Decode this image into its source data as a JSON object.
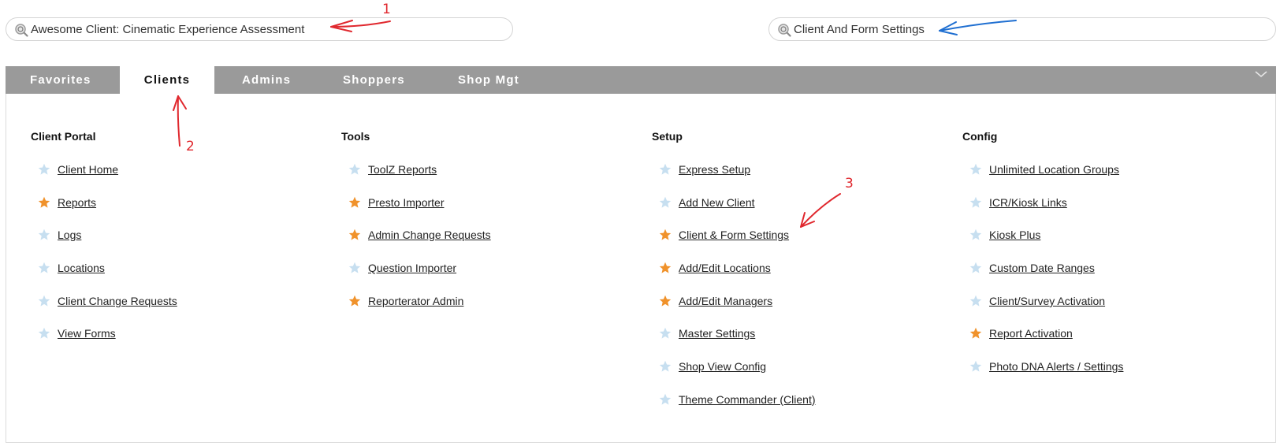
{
  "search_left": {
    "value": "Awesome Client: Cinematic Experience Assessment",
    "icon": "search-icon"
  },
  "search_right": {
    "value": "Client And Form Settings",
    "icon": "search-icon"
  },
  "tabs": [
    {
      "label": "Favorites",
      "active": false
    },
    {
      "label": "Clients",
      "active": true
    },
    {
      "label": "Admins",
      "active": false
    },
    {
      "label": "Shoppers",
      "active": false
    },
    {
      "label": "Shop Mgt",
      "active": false
    }
  ],
  "colors": {
    "tabbar": "#9a9a9a",
    "star_favorite": "#f0922b",
    "star_default": "#c7dff0",
    "annotation_red": "#e0282e",
    "annotation_blue": "#1f6fd1"
  },
  "columns": [
    {
      "heading": "Client Portal",
      "items": [
        {
          "label": "Client Home",
          "starred": false
        },
        {
          "label": "Reports",
          "starred": true
        },
        {
          "label": "Logs",
          "starred": false
        },
        {
          "label": "Locations",
          "starred": false
        },
        {
          "label": "Client Change Requests",
          "starred": false
        },
        {
          "label": "View Forms",
          "starred": false
        }
      ]
    },
    {
      "heading": "Tools",
      "items": [
        {
          "label": "ToolZ Reports",
          "starred": false
        },
        {
          "label": "Presto Importer",
          "starred": true
        },
        {
          "label": "Admin Change Requests",
          "starred": true
        },
        {
          "label": "Question Importer",
          "starred": false
        },
        {
          "label": "Reporterator Admin",
          "starred": true
        }
      ]
    },
    {
      "heading": "Setup",
      "items": [
        {
          "label": "Express Setup",
          "starred": false
        },
        {
          "label": "Add New Client",
          "starred": false
        },
        {
          "label": "Client & Form Settings",
          "starred": true
        },
        {
          "label": "Add/Edit Locations",
          "starred": true
        },
        {
          "label": "Add/Edit Managers",
          "starred": true
        },
        {
          "label": "Master Settings",
          "starred": false
        },
        {
          "label": "Shop View Config",
          "starred": false
        },
        {
          "label": "Theme Commander (Client)",
          "starred": false
        }
      ]
    },
    {
      "heading": "Config",
      "items": [
        {
          "label": "Unlimited Location Groups",
          "starred": false
        },
        {
          "label": "ICR/Kiosk Links",
          "starred": false
        },
        {
          "label": "Kiosk Plus",
          "starred": false
        },
        {
          "label": "Custom Date Ranges",
          "starred": false
        },
        {
          "label": "Client/Survey Activation",
          "starred": false
        },
        {
          "label": "Report Activation",
          "starred": true
        },
        {
          "label": "Photo DNA Alerts / Settings",
          "starred": false
        }
      ]
    }
  ],
  "annotations": [
    "1",
    "2",
    "3"
  ]
}
